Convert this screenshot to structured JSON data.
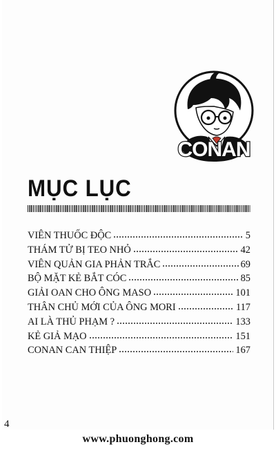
{
  "page": {
    "emblem_text": "CONAN",
    "title": "MỤC LỤC",
    "page_number": "4",
    "footer_url": "www.phuonghong.com"
  },
  "toc": [
    {
      "title": "VIÊN THUỐC ĐỘC",
      "page": "5"
    },
    {
      "title": "THÁM TỬ BỊ TEO NHỎ",
      "page": "42"
    },
    {
      "title": "VIÊN QUẢN GIA PHẢN TRẮC",
      "page": "69"
    },
    {
      "title": "BỘ MẶT KẺ BẮT CÓC",
      "page": "85"
    },
    {
      "title": "GIẢI OAN CHO ÔNG MASO",
      "page": "101"
    },
    {
      "title": "THÂN CHỦ MỚI CỦA ÔNG MORI",
      "page": "117"
    },
    {
      "title": "AI LÀ THỦ PHẠM ?",
      "page": "133"
    },
    {
      "title": "KẺ GIẢ MẠO",
      "page": "151"
    },
    {
      "title": "CONAN CAN THIỆP",
      "page": "167"
    }
  ]
}
